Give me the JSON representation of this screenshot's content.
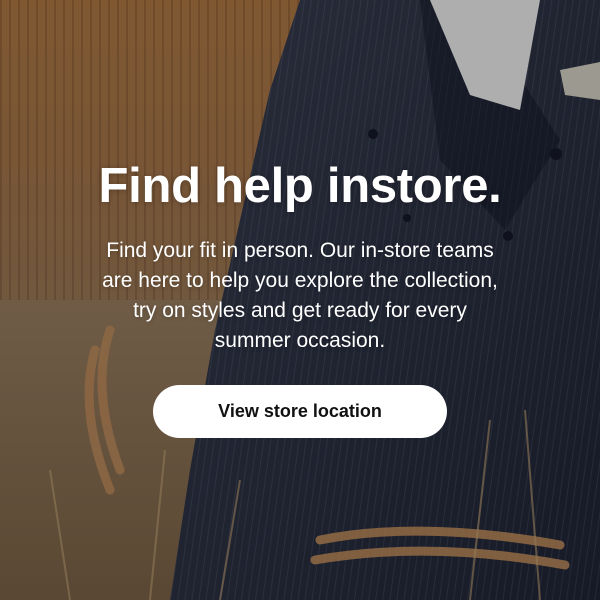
{
  "hero": {
    "headline": "Find help instore.",
    "body": "Find your fit in person. Our in-store teams are here to help you explore the collection, try on styles and get ready for every summer occasion.",
    "cta_label": "View store location"
  },
  "colors": {
    "text": "#ffffff",
    "button_bg": "#ffffff",
    "button_text": "#111111"
  }
}
